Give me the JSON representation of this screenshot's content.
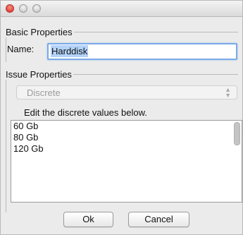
{
  "window": {
    "controls": {
      "close": "close-icon",
      "minimize": "minimize-icon",
      "maximize": "maximize-icon"
    }
  },
  "basic_properties": {
    "title": "Basic Properties",
    "name_label": "Name:",
    "name_value": "Harddisk"
  },
  "issue_properties": {
    "title": "Issue Properties",
    "type_select": "Discrete",
    "hint": "Edit the discrete values below.",
    "values": [
      "60 Gb",
      "80 Gb",
      "120 Gb"
    ]
  },
  "buttons": {
    "ok": "Ok",
    "cancel": "Cancel"
  },
  "colors": {
    "focus_ring": "#7aa9e6",
    "selection": "#b3d3f8",
    "close_button": "#e0443a"
  }
}
